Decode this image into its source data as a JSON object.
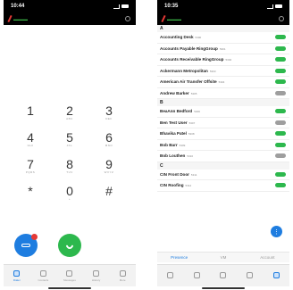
{
  "left_phone": {
    "time": "10:44",
    "keys": [
      {
        "digit": "1",
        "letters": ""
      },
      {
        "digit": "2",
        "letters": "ABC"
      },
      {
        "digit": "3",
        "letters": "DEF"
      },
      {
        "digit": "4",
        "letters": "GHI"
      },
      {
        "digit": "5",
        "letters": "JKL"
      },
      {
        "digit": "6",
        "letters": "MNO"
      },
      {
        "digit": "7",
        "letters": "PQRS"
      },
      {
        "digit": "8",
        "letters": "TUV"
      },
      {
        "digit": "9",
        "letters": "WXYZ"
      },
      {
        "digit": "*",
        "letters": ""
      },
      {
        "digit": "0",
        "letters": "+"
      },
      {
        "digit": "#",
        "letters": ""
      }
    ],
    "tabs": [
      {
        "label": "Dialer"
      },
      {
        "label": "Contacts"
      },
      {
        "label": "Messages"
      },
      {
        "label": "History"
      },
      {
        "label": "More"
      }
    ]
  },
  "right_phone": {
    "time": "10:35",
    "sections": [
      {
        "letter": "A",
        "entries": [
          {
            "name": "Accounting Desk",
            "ext": "5300",
            "status": "online"
          },
          {
            "name": "Accounts Payable RingGroup",
            "ext": "5301",
            "status": "online"
          },
          {
            "name": "Accounts Receivable RingGroup",
            "ext": "5302",
            "status": "online"
          },
          {
            "name": "Ackermann Metropolitan",
            "ext": "5303",
            "status": "online"
          },
          {
            "name": "American Air Transfer Offsite",
            "ext": "5304",
            "status": "online"
          },
          {
            "name": "Andrew Barker",
            "ext": "5305",
            "status": "offline"
          }
        ]
      },
      {
        "letter": "B",
        "entries": [
          {
            "name": "BeaAnn Bedford",
            "ext": "5306",
            "status": "online"
          },
          {
            "name": "Ben Test User",
            "ext": "5307",
            "status": "offline"
          },
          {
            "name": "Bhavika Patel",
            "ext": "5308",
            "status": "online"
          },
          {
            "name": "Bob Barr",
            "ext": "5309",
            "status": "online"
          },
          {
            "name": "Bob Louthen",
            "ext": "5310",
            "status": "offline"
          }
        ]
      },
      {
        "letter": "C",
        "entries": [
          {
            "name": "CIN Front Door",
            "ext": "5311",
            "status": "online"
          },
          {
            "name": "CIN Roofing",
            "ext": "5312",
            "status": "online"
          }
        ]
      }
    ],
    "segments": [
      {
        "label": "Presence"
      },
      {
        "label": "VM"
      },
      {
        "label": "Account"
      }
    ],
    "tabs": [
      {
        "label": ""
      },
      {
        "label": ""
      },
      {
        "label": ""
      },
      {
        "label": ""
      },
      {
        "label": ""
      }
    ]
  }
}
